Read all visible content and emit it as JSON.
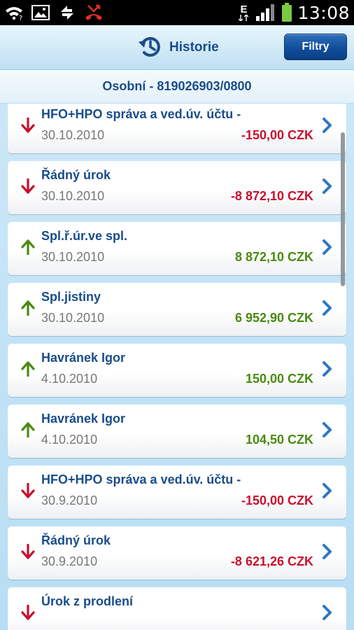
{
  "status_bar": {
    "time": "13:08",
    "network_label": "E"
  },
  "header": {
    "title": "Historie",
    "filter_label": "Filtry"
  },
  "account": {
    "label": "Osobní - 819026903/0800"
  },
  "transactions": [
    {
      "title": "HFO+HPO správa a ved.úv. účtu -",
      "date": "30.10.2010",
      "amount": "-150,00 CZK",
      "direction": "out"
    },
    {
      "title": "Řádný úrok",
      "date": "30.10.2010",
      "amount": "-8 872,10 CZK",
      "direction": "out"
    },
    {
      "title": "Spl.ř.úr.ve spl.",
      "date": "30.10.2010",
      "amount": "8 872,10 CZK",
      "direction": "in"
    },
    {
      "title": "Spl.jistiny",
      "date": "30.10.2010",
      "amount": "6 952,90 CZK",
      "direction": "in"
    },
    {
      "title": "Havránek Igor",
      "date": "4.10.2010",
      "amount": "150,00 CZK",
      "direction": "in"
    },
    {
      "title": "Havránek Igor",
      "date": "4.10.2010",
      "amount": "104,50 CZK",
      "direction": "in"
    },
    {
      "title": "HFO+HPO správa a ved.úv. účtu -",
      "date": "30.9.2010",
      "amount": "-150,00 CZK",
      "direction": "out"
    },
    {
      "title": "Řádný úrok",
      "date": "30.9.2010",
      "amount": "-8 621,26 CZK",
      "direction": "out"
    },
    {
      "title": "Úrok z prodlení",
      "date": "",
      "amount": "",
      "direction": "out"
    }
  ],
  "colors": {
    "title_blue": "#1a4d8a",
    "negative_red": "#c8102e",
    "positive_green": "#4a8a10",
    "filter_button": "#104e9c"
  }
}
